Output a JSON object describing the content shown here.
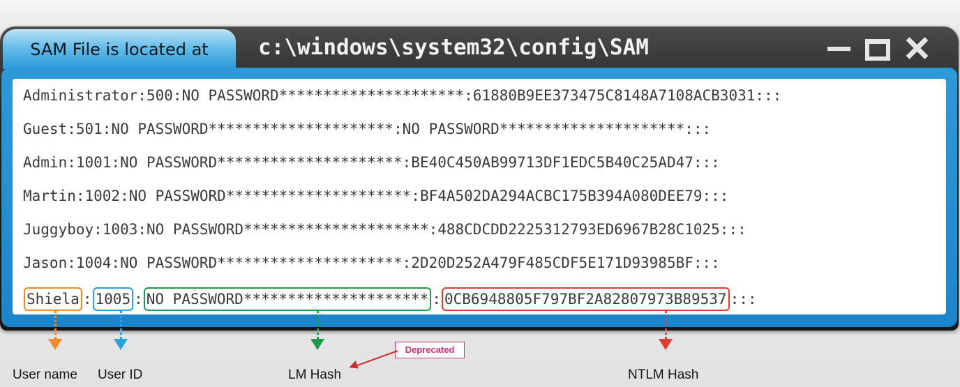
{
  "window": {
    "tab_label": "SAM File is located at",
    "path": "c:\\windows\\system32\\config\\SAM"
  },
  "sam_lines": [
    "Administrator:500:NO PASSWORD*********************:61880B9EE373475C8148A7108ACB3031:::",
    "Guest:501:NO PASSWORD*********************:NO PASSWORD*********************:::",
    "Admin:1001:NO PASSWORD*********************:BE40C450AB99713DF1EDC5B40C25AD47:::",
    "Martin:1002:NO PASSWORD*********************:BF4A502DA294ACBC175B394A080DEE79:::",
    "Juggyboy:1003:NO PASSWORD*********************:488CDCDD2225312793ED6967B28C1025:::",
    "Jason:1004:NO PASSWORD*********************:2D20D252A479F485CDF5E171D93985BF:::"
  ],
  "last_line": {
    "user": "Shiela",
    "sep1": ":",
    "id": "1005",
    "sep2": ":",
    "lm": "NO PASSWORD*********************",
    "sep3": ":",
    "ntlm": "0CB6948805F797BF2A82807973B89537",
    "tail": ":::"
  },
  "labels": {
    "user_name": "User name",
    "user_id": "User ID",
    "lm_hash": "LM Hash",
    "ntlm_hash": "NTLM Hash",
    "deprecated": "Deprecated"
  },
  "colors": {
    "user": "#f08a24",
    "id": "#29a2e0",
    "lm": "#1f9a4c",
    "ntlm": "#e23b2e",
    "deprecated": "#d0307a"
  },
  "icons": [
    "minimize-icon",
    "maximize-icon",
    "close-icon"
  ]
}
